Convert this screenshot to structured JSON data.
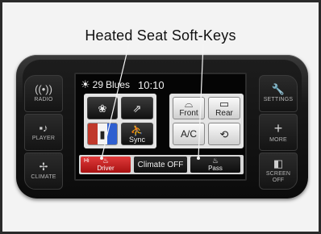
{
  "caption": "Heated Seat Soft-Keys",
  "hardkeys": {
    "left": [
      {
        "label": "RADIO",
        "icon": "radio-waves-icon"
      },
      {
        "label": "PLAYER",
        "icon": "media-player-icon"
      },
      {
        "label": "CLIMATE",
        "icon": "fan-icon"
      }
    ],
    "right": [
      {
        "label": "SETTINGS",
        "icon": "wrench-icon"
      },
      {
        "label": "MORE",
        "icon": "plus-icon"
      },
      {
        "label": "SCREEN OFF",
        "icon": "screen-off-icon"
      }
    ]
  },
  "screen": {
    "status": {
      "temperature": "29",
      "location": "Blues",
      "time": "10:10"
    },
    "tiles": {
      "fan_icon": "fan-icon",
      "mode_icon": "airflow-mode-icon",
      "temp_icon": "temperature-split-icon",
      "sync_label": "Sync",
      "front_label": "Front",
      "rear_label": "Rear",
      "ac_label": "A/C",
      "recirc_icon": "recirculation-icon"
    },
    "bottom": {
      "driver_hi": "Hi",
      "driver_label": "Driver",
      "climate_off_label": "Climate OFF",
      "pass_label": "Pass"
    }
  },
  "colors": {
    "driver_active": "#d42a2a",
    "hot": "#c0392b",
    "cold": "#2f5fd0"
  }
}
